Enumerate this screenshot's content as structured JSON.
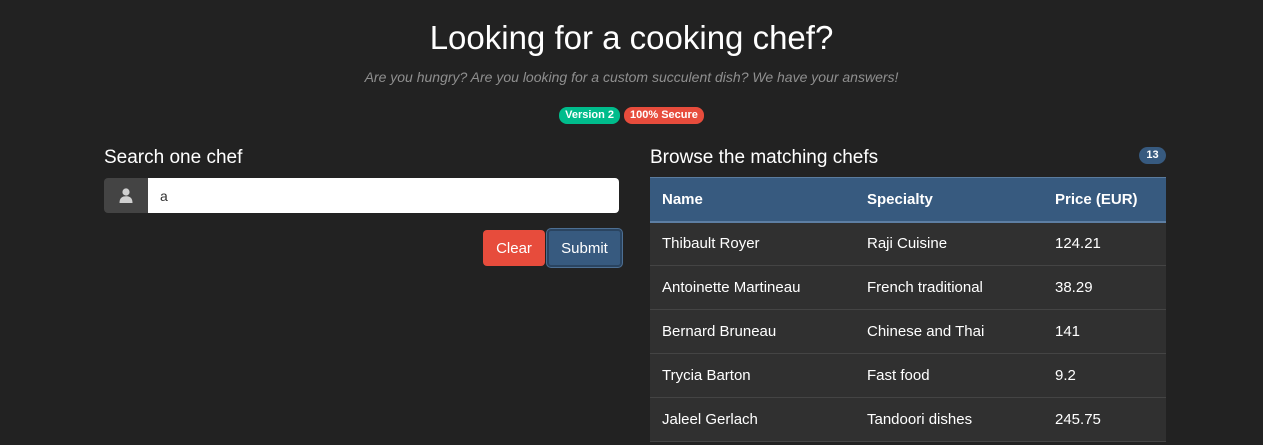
{
  "header": {
    "title": "Looking for a cooking chef?",
    "subtitle": "Are you hungry? Are you looking for a custom succulent dish? We have your answers!",
    "badges": [
      {
        "label": "Version 2",
        "color": "#00bc8c"
      },
      {
        "label": "100% Secure",
        "color": "#e74c3c"
      }
    ]
  },
  "search": {
    "heading": "Search one chef",
    "addon_icon": "user-icon",
    "value": "a",
    "clear_label": "Clear",
    "submit_label": "Submit"
  },
  "results": {
    "heading": "Browse the matching chefs",
    "count": "13",
    "columns": [
      "Name",
      "Specialty",
      "Price (EUR)"
    ],
    "rows": [
      {
        "name": "Thibault Royer",
        "specialty": "Raji Cuisine",
        "price": "124.21"
      },
      {
        "name": "Antoinette Martineau",
        "specialty": "French traditional",
        "price": "38.29"
      },
      {
        "name": "Bernard Bruneau",
        "specialty": "Chinese and Thai",
        "price": "141"
      },
      {
        "name": "Trycia Barton",
        "specialty": "Fast food",
        "price": "9.2"
      },
      {
        "name": "Jaleel Gerlach",
        "specialty": "Tandoori dishes",
        "price": "245.75"
      }
    ]
  },
  "colors": {
    "background": "#222222",
    "primary": "#375a7f",
    "success": "#00bc8c",
    "danger": "#e74c3c"
  }
}
